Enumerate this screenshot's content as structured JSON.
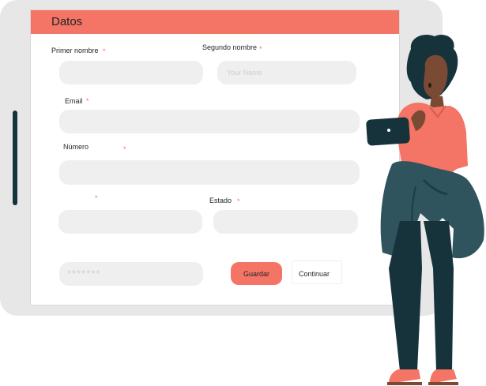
{
  "form": {
    "title": "Datos",
    "first_name_label": "Primer nombre",
    "second_name_label": "Segundo nombre",
    "second_name_placeholder": "Your Name",
    "email_label": "Email",
    "number_label": "Número",
    "state_label": "Estado",
    "required_mark": "*",
    "password_mask": "*******",
    "save_label": "Guardar",
    "continue_label": "Continuar"
  },
  "colors": {
    "accent": "#f47466",
    "field_bg": "#efefef",
    "tablet_frame": "#e7e7e7",
    "dark": "#16323a"
  },
  "illustration": {
    "icon": "woman-holding-tablet-illustration"
  }
}
